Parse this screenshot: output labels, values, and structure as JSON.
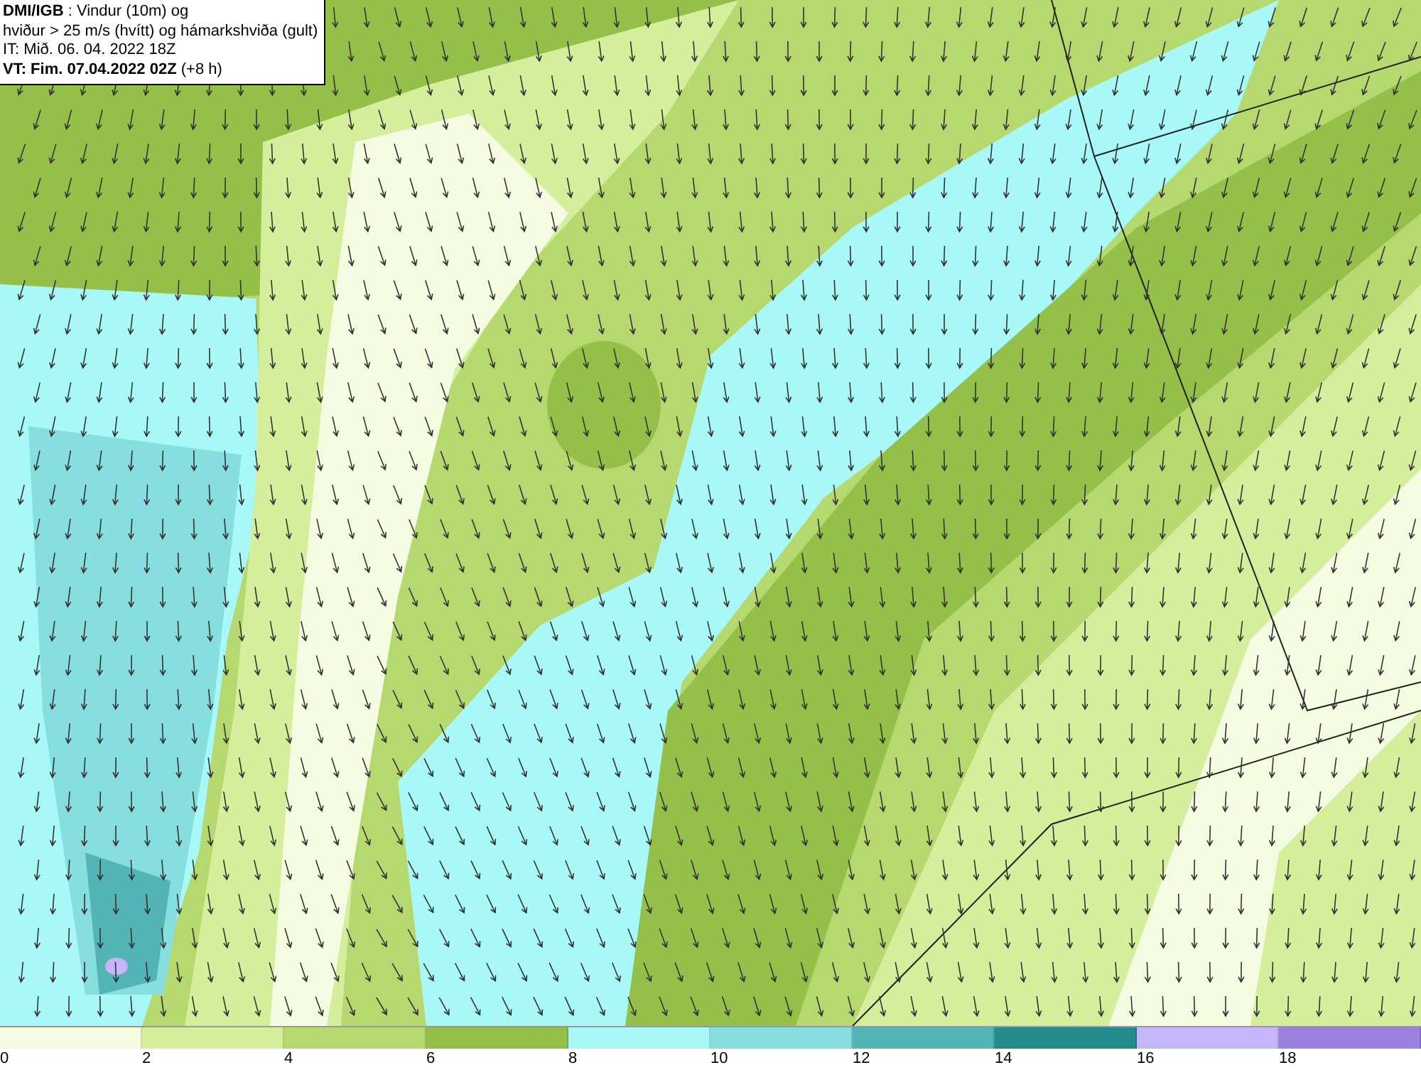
{
  "info_box": {
    "lines": [
      "**DMI/IGB** : Vindur (10m) og",
      "hviður > 25 m/s (hvítt) og hámarkshviða (gult)",
      "IT: Mið. 06. 04. 2022 18Z",
      "**VT: Fim. 07.04.2022 02Z** (+8 h)"
    ]
  },
  "legend": {
    "bins": [
      {
        "label": "0",
        "color": "#f5fbe0"
      },
      {
        "label": "2",
        "color": "#d4ee9c"
      },
      {
        "label": "4",
        "color": "#b5d96e"
      },
      {
        "label": "6",
        "color": "#94c04a"
      },
      {
        "label": "8",
        "color": "#a8f8f8"
      },
      {
        "label": "10",
        "color": "#86dede"
      },
      {
        "label": "12",
        "color": "#52b4b4"
      },
      {
        "label": "14",
        "color": "#238c8c"
      },
      {
        "label": "16",
        "color": "#c4b6f8"
      },
      {
        "label": "18",
        "color": "#9c82e0"
      }
    ]
  }
}
